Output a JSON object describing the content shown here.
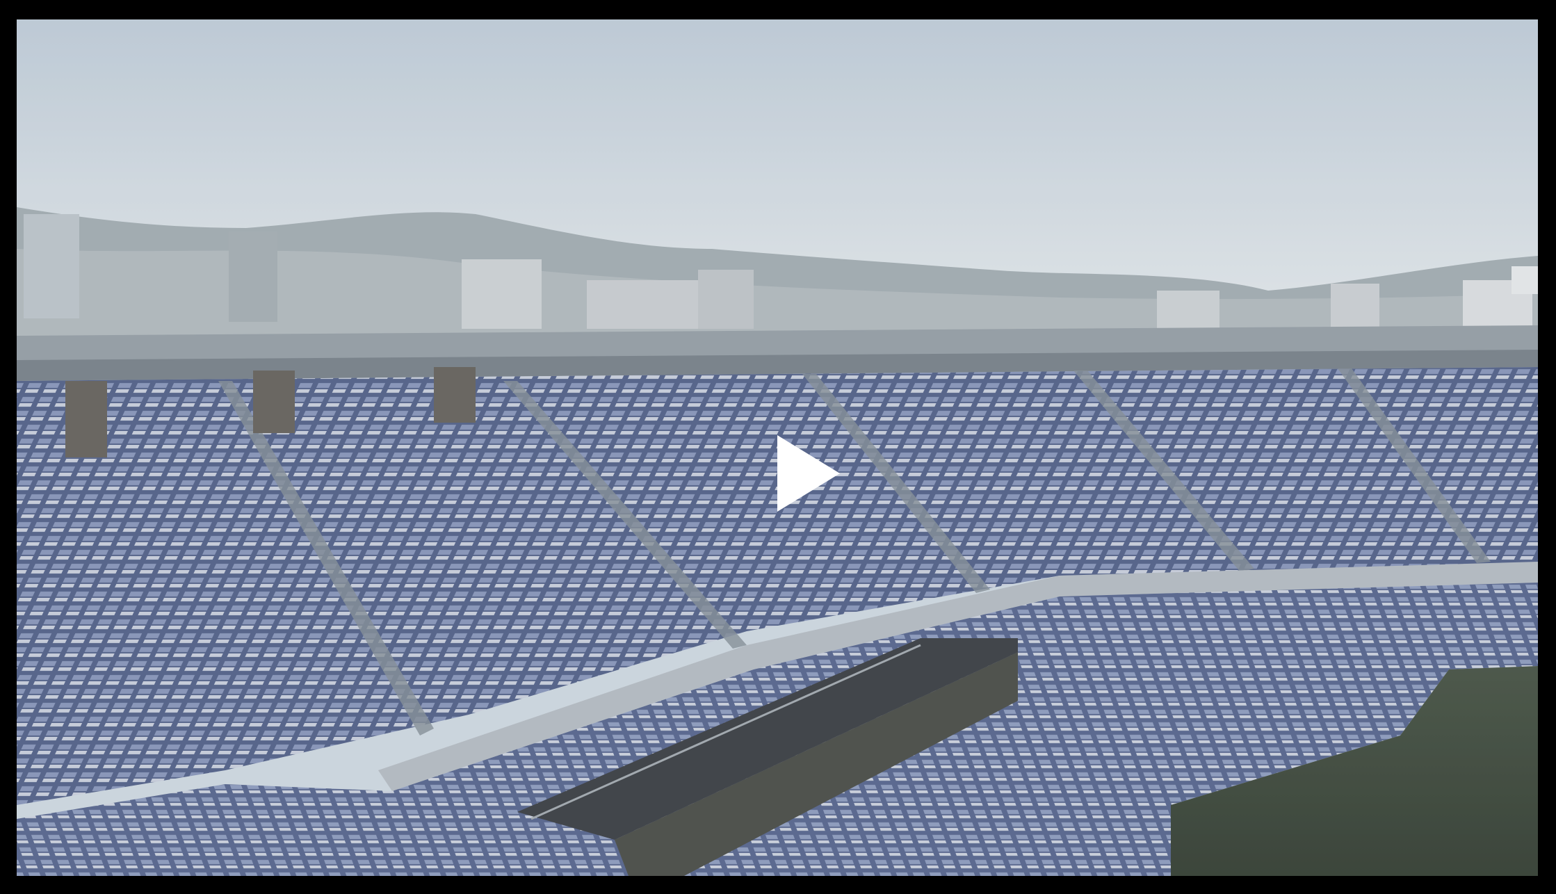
{
  "player": {
    "state": "paused",
    "play_icon": "play-icon"
  },
  "video_frame": {
    "scene": "stadium-stands",
    "seat_color": "#4f5f8e",
    "sky_color": "#cdd6df",
    "pitch_color": "#2f3a30"
  }
}
